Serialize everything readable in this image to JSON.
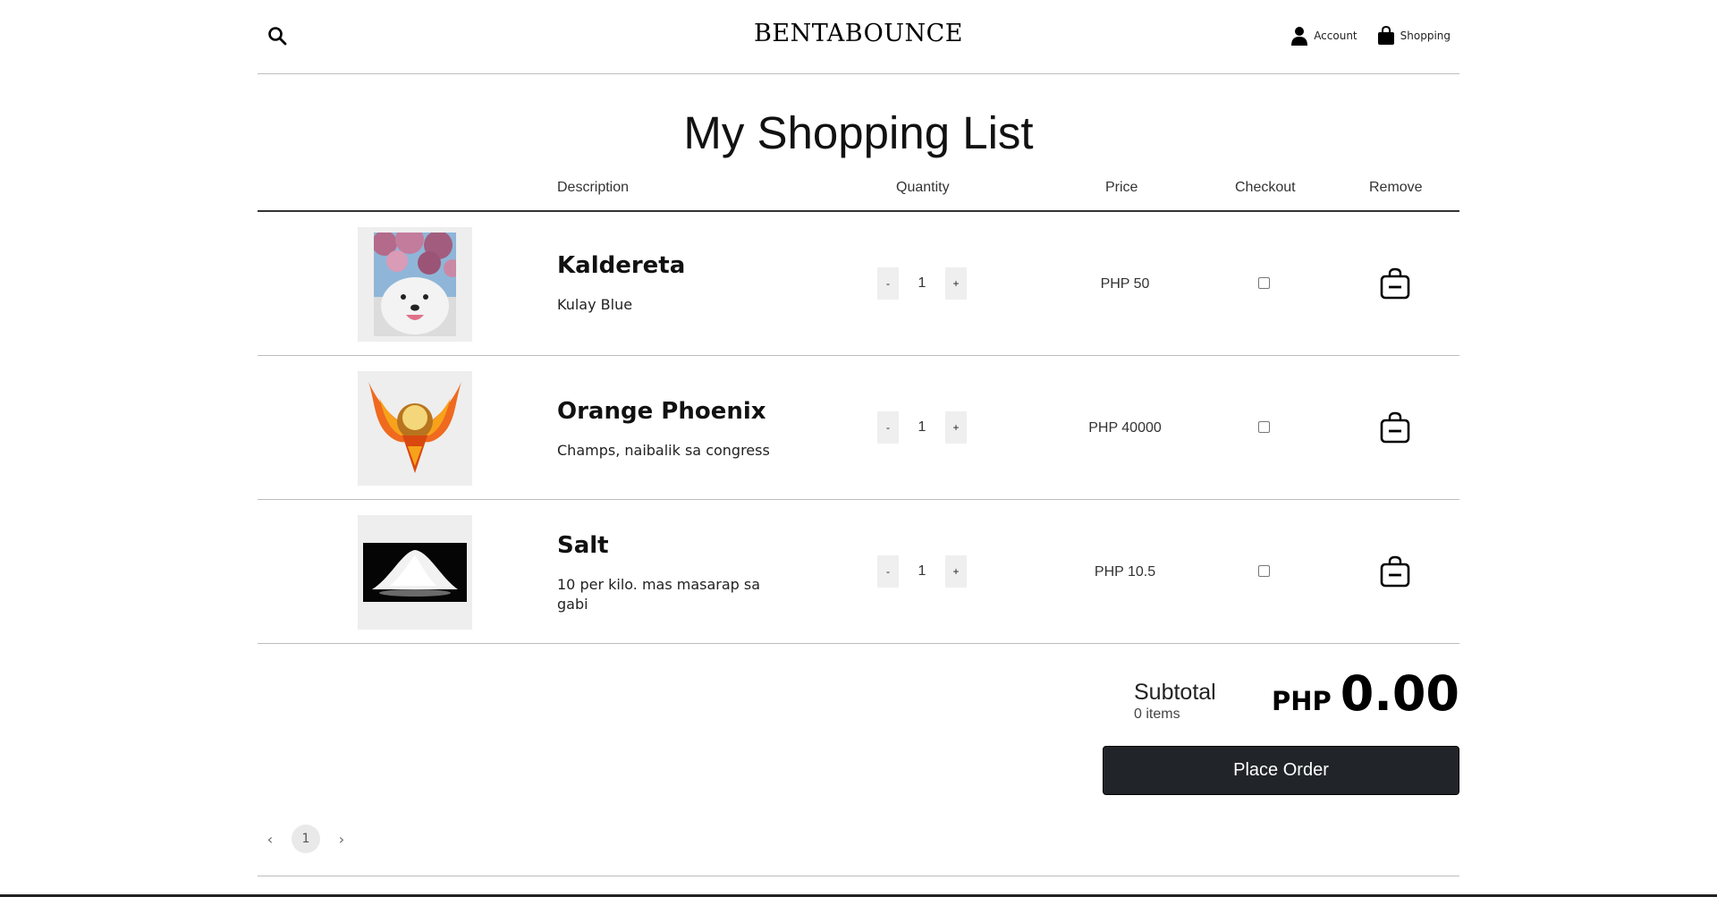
{
  "header": {
    "brand": "BENTABOUNCE",
    "account_label": "Account",
    "shopping_label": "Shopping"
  },
  "page": {
    "title": "My Shopping List"
  },
  "table": {
    "columns": [
      "Description",
      "Quantity",
      "Price",
      "Checkout",
      "Remove"
    ],
    "rows": [
      {
        "name": "Kaldereta",
        "description": "Kulay Blue",
        "quantity": "1",
        "price": "PHP 50",
        "checked": false,
        "image": "samoyed-dog-photo"
      },
      {
        "name": "Orange Phoenix",
        "description": "Champs, naibalik sa congress",
        "quantity": "1",
        "price": "PHP 40000",
        "checked": false,
        "image": "orange-phoenix-emblem"
      },
      {
        "name": "Salt",
        "description": "10 per kilo. mas masarap sa gabi",
        "quantity": "1",
        "price": "PHP 10.5",
        "checked": false,
        "image": "salt-pile-photo"
      }
    ],
    "minus_label": "-",
    "plus_label": "+"
  },
  "summary": {
    "subtotal_label": "Subtotal",
    "items_count": "0 items",
    "currency": "PHP",
    "amount": "0.00",
    "place_order_label": "Place Order"
  },
  "pagination": {
    "prev": "‹",
    "current": "1",
    "next": "›"
  },
  "colors": {
    "button_dark": "#212529",
    "thumb_bg": "#eeeeee"
  }
}
